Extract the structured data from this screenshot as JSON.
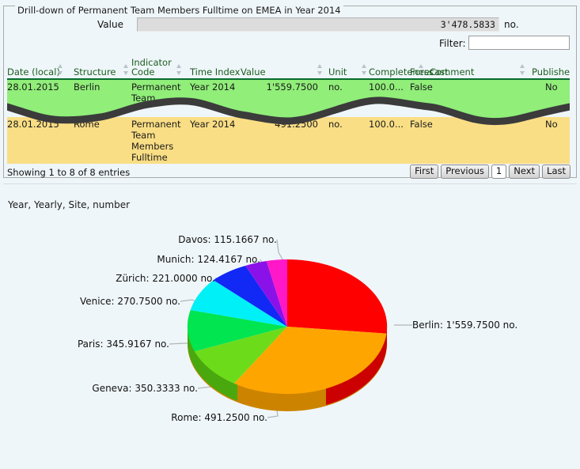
{
  "groupbox": {
    "legend": "Drill-down of Permanent Team Members Fulltime on EMEA in Year 2014"
  },
  "value_field": {
    "label": "Value",
    "value": "3'478.5833",
    "unit": "no."
  },
  "filter": {
    "label": "Filter:",
    "value": "",
    "placeholder": ""
  },
  "table": {
    "headers": [
      "Date (local)",
      "Structure",
      "Indicator Code",
      "Time Index",
      "Value",
      "Unit",
      "Completeness",
      "Forecast",
      "Comment",
      "Published"
    ],
    "rows": [
      {
        "date": "28.01.2015",
        "structure": "Berlin",
        "indicator": "Permanent\nTeam\nMembers\nFulltime",
        "time_index": "Year 2014",
        "value": "1'559.7500",
        "unit": "no.",
        "completeness": "100.0...",
        "forecast": "False",
        "comment": "",
        "published": "No"
      },
      {
        "date": "28.01.2015",
        "structure": "Rome",
        "indicator": "Permanent\nTeam\nMembers\nFulltime",
        "time_index": "Year 2014",
        "value": "491.2500",
        "unit": "no.",
        "completeness": "100.0...",
        "forecast": "False",
        "comment": "",
        "published": "No"
      }
    ],
    "footer": "Showing 1 to 8 of 8 entries"
  },
  "pager": {
    "first": "First",
    "previous": "Previous",
    "current": "1",
    "next": "Next",
    "last": "Last"
  },
  "subtitle": "Year, Yearly, Site, number",
  "chart_data": {
    "type": "pie",
    "title": "",
    "subtitle": "Year, Yearly, Site, number",
    "unit": "no.",
    "total": "3'478.5833",
    "legend_position": "callout-labels",
    "categories": [
      "Berlin",
      "Rome",
      "Geneva",
      "Paris",
      "Venice",
      "Zürich",
      "Munich",
      "Davos"
    ],
    "values": [
      1559.75,
      491.25,
      350.3333,
      345.9167,
      270.75,
      221.0,
      124.4167,
      115.1667
    ],
    "colors": [
      "#ff0000",
      "#ffa500",
      "#6cdc1a",
      "#00e550",
      "#00f0f8",
      "#1228f5",
      "#8a12e8",
      "#ff18c8"
    ],
    "labels": [
      "Berlin: 1'559.7500 no.",
      "Rome: 491.2500 no.",
      "Geneva: 350.3333 no.",
      "Paris: 345.9167 no.",
      "Venice: 270.7500 no.",
      "Zürich: 221.0000 no.",
      "Munich: 124.4167 no.",
      "Davos: 115.1667 no."
    ]
  }
}
